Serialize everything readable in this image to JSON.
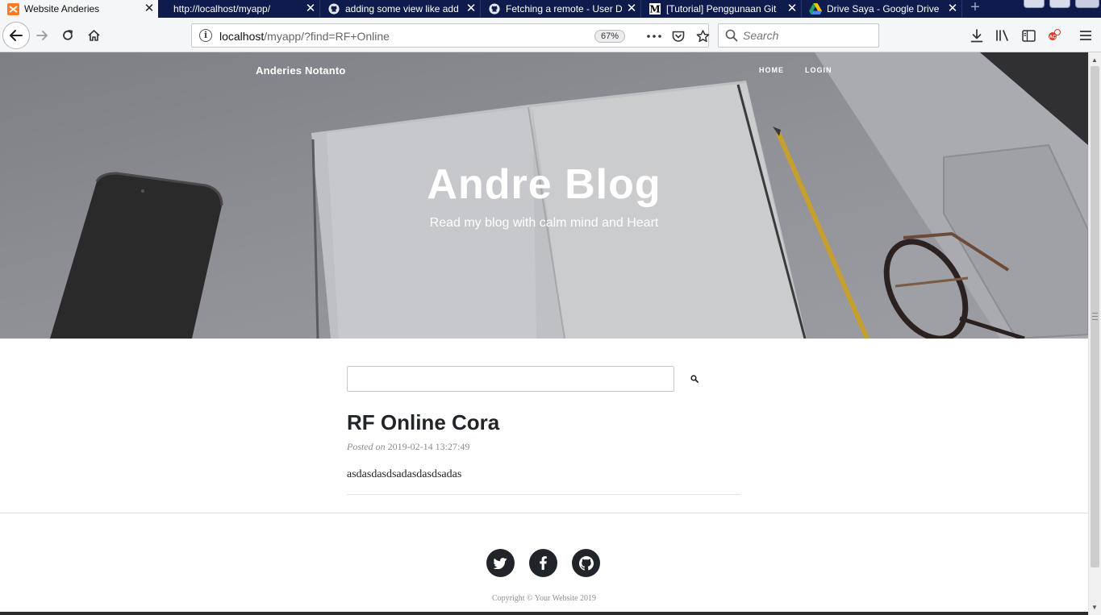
{
  "browser": {
    "tabs": [
      {
        "title": "Website Anderies",
        "icon": "xampp-icon",
        "active": true
      },
      {
        "title": "http://localhost/myapp/",
        "icon": "",
        "active": false
      },
      {
        "title": "adding some view like add",
        "icon": "github-icon",
        "active": false
      },
      {
        "title": "Fetching a remote - User Do",
        "icon": "github-icon",
        "active": false
      },
      {
        "title": "[Tutorial] Penggunaan Git",
        "icon": "medium-icon",
        "active": false
      },
      {
        "title": "Drive Saya - Google Drive",
        "icon": "google-drive-icon",
        "active": false
      }
    ],
    "url": {
      "host": "localhost",
      "path": "/myapp/?find=RF+Online"
    },
    "zoom": "67%",
    "search_placeholder": "Search"
  },
  "site": {
    "brand": "Anderies Notanto",
    "nav": [
      {
        "label": "HOME"
      },
      {
        "label": "LOGIN"
      }
    ],
    "hero": {
      "title": "Andre Blog",
      "subtitle": "Read my blog with calm mind and Heart"
    },
    "search": {
      "value": "",
      "button_icon": "search-icon"
    },
    "posts": [
      {
        "title": "RF Online Cora",
        "meta_prefix": "Posted on",
        "date": "2019-02-14 13:27:49",
        "body": "asdasdasdsadasdasdsadas"
      }
    ],
    "footer": {
      "socials": [
        "twitter-icon",
        "facebook-icon",
        "github-icon"
      ],
      "copyright": "Copyright © Your Website 2019"
    }
  },
  "colors": {
    "tabstrip": "#0f1b4c",
    "text_dark": "#212529",
    "text_muted": "#868e96",
    "social_bg": "#212529"
  }
}
